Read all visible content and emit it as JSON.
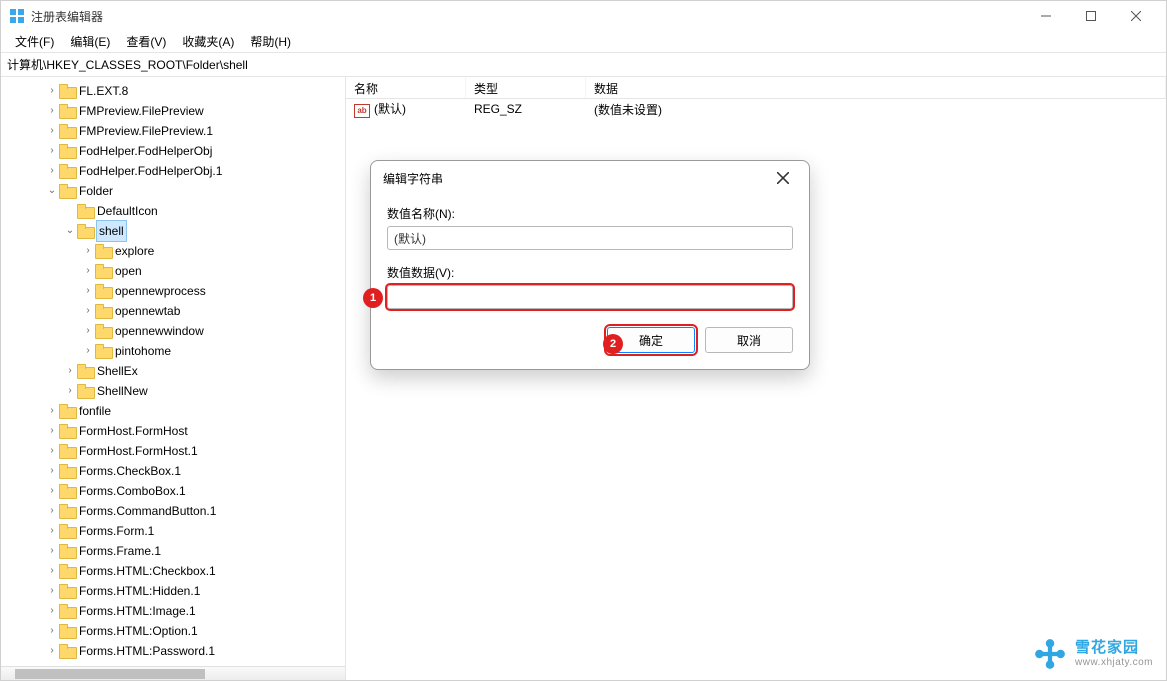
{
  "window": {
    "title": "注册表编辑器"
  },
  "menu": {
    "file": "文件(F)",
    "edit": "编辑(E)",
    "view": "查看(V)",
    "fav": "收藏夹(A)",
    "help": "帮助(H)"
  },
  "address": "计算机\\HKEY_CLASSES_ROOT\\Folder\\shell",
  "tree": [
    {
      "indent": 2,
      "exp": ">",
      "label": "FL.EXT.8"
    },
    {
      "indent": 2,
      "exp": ">",
      "label": "FMPreview.FilePreview"
    },
    {
      "indent": 2,
      "exp": ">",
      "label": "FMPreview.FilePreview.1"
    },
    {
      "indent": 2,
      "exp": ">",
      "label": "FodHelper.FodHelperObj"
    },
    {
      "indent": 2,
      "exp": ">",
      "label": "FodHelper.FodHelperObj.1"
    },
    {
      "indent": 2,
      "exp": "v",
      "label": "Folder"
    },
    {
      "indent": 3,
      "exp": "",
      "label": "DefaultIcon"
    },
    {
      "indent": 3,
      "exp": "v",
      "label": "shell",
      "selected": true
    },
    {
      "indent": 4,
      "exp": ">",
      "label": "explore"
    },
    {
      "indent": 4,
      "exp": ">",
      "label": "open"
    },
    {
      "indent": 4,
      "exp": ">",
      "label": "opennewprocess"
    },
    {
      "indent": 4,
      "exp": ">",
      "label": "opennewtab"
    },
    {
      "indent": 4,
      "exp": ">",
      "label": "opennewwindow"
    },
    {
      "indent": 4,
      "exp": ">",
      "label": "pintohome"
    },
    {
      "indent": 3,
      "exp": ">",
      "label": "ShellEx"
    },
    {
      "indent": 3,
      "exp": ">",
      "label": "ShellNew"
    },
    {
      "indent": 2,
      "exp": ">",
      "label": "fonfile"
    },
    {
      "indent": 2,
      "exp": ">",
      "label": "FormHost.FormHost"
    },
    {
      "indent": 2,
      "exp": ">",
      "label": "FormHost.FormHost.1"
    },
    {
      "indent": 2,
      "exp": ">",
      "label": "Forms.CheckBox.1"
    },
    {
      "indent": 2,
      "exp": ">",
      "label": "Forms.ComboBox.1"
    },
    {
      "indent": 2,
      "exp": ">",
      "label": "Forms.CommandButton.1"
    },
    {
      "indent": 2,
      "exp": ">",
      "label": "Forms.Form.1"
    },
    {
      "indent": 2,
      "exp": ">",
      "label": "Forms.Frame.1"
    },
    {
      "indent": 2,
      "exp": ">",
      "label": "Forms.HTML:Checkbox.1"
    },
    {
      "indent": 2,
      "exp": ">",
      "label": "Forms.HTML:Hidden.1"
    },
    {
      "indent": 2,
      "exp": ">",
      "label": "Forms.HTML:Image.1"
    },
    {
      "indent": 2,
      "exp": ">",
      "label": "Forms.HTML:Option.1"
    },
    {
      "indent": 2,
      "exp": ">",
      "label": "Forms.HTML:Password.1"
    }
  ],
  "list": {
    "headers": {
      "name": "名称",
      "type": "类型",
      "data": "数据"
    },
    "rows": [
      {
        "name": "(默认)",
        "type": "REG_SZ",
        "data": "(数值未设置)"
      }
    ]
  },
  "dialog": {
    "title": "编辑字符串",
    "name_label": "数值名称(N):",
    "name_value": "(默认)",
    "data_label": "数值数据(V):",
    "data_value": "",
    "ok": "确定",
    "cancel": "取消"
  },
  "callouts": {
    "c1": "1",
    "c2": "2"
  },
  "watermark": {
    "zh": "雪花家园",
    "en": "www.xhjaty.com"
  }
}
